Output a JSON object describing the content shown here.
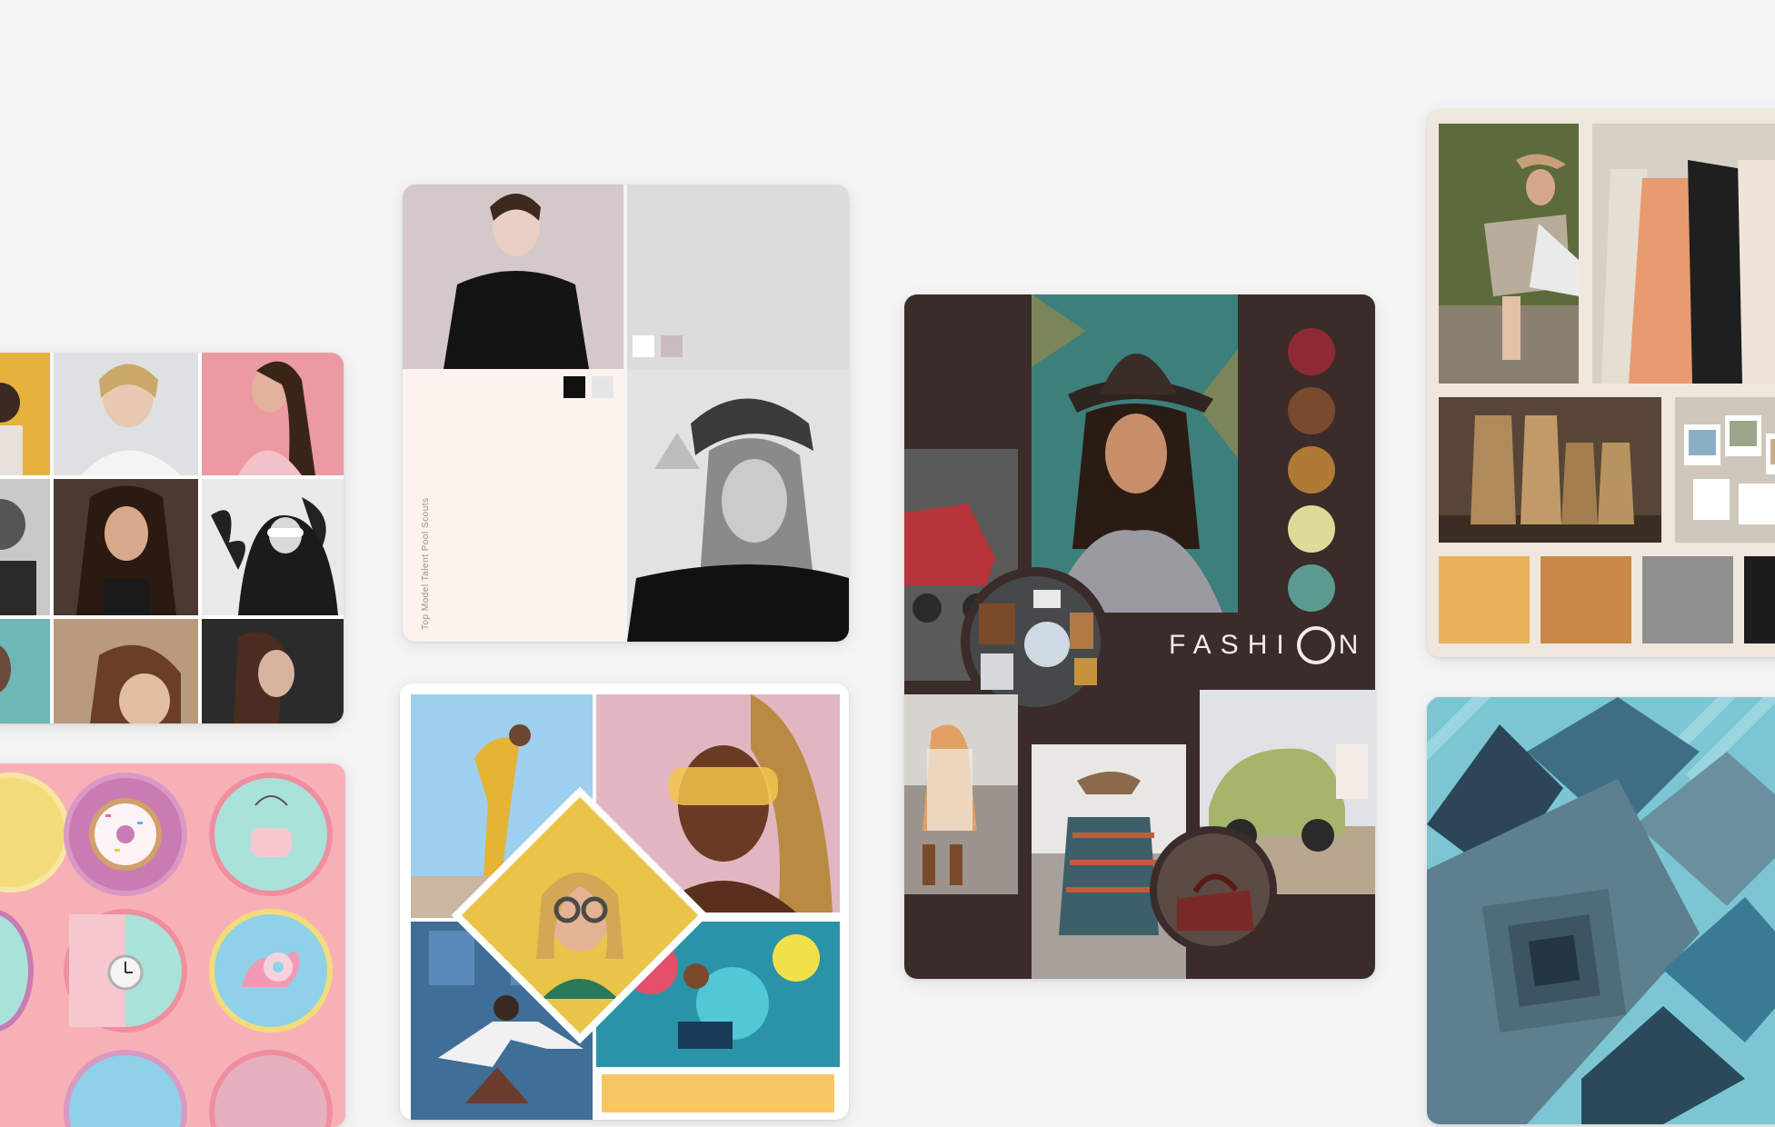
{
  "cards": {
    "model_talent": {
      "vertical_text": "Top Model Talent Pool Scouts",
      "swatches": [
        "#ffffff",
        "#c9bcbe",
        "#101010",
        "#e6e6e6"
      ]
    },
    "fashion": {
      "title_prefix": "FASHI",
      "title_suffix": "N",
      "palette": [
        "#8e2a33",
        "#7a4a2f",
        "#b07a35",
        "#dcdc98",
        "#5b9a91"
      ]
    },
    "western": {
      "palette": [
        "#eab25d",
        "#c98a47",
        "#8f8f8f",
        "#1c1c1c"
      ]
    }
  }
}
